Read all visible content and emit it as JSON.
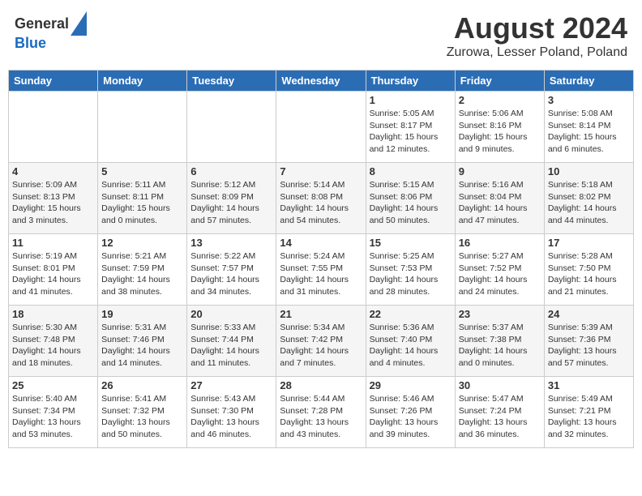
{
  "header": {
    "logo_general": "General",
    "logo_blue": "Blue",
    "month_title": "August 2024",
    "location": "Zurowa, Lesser Poland, Poland"
  },
  "days_of_week": [
    "Sunday",
    "Monday",
    "Tuesday",
    "Wednesday",
    "Thursday",
    "Friday",
    "Saturday"
  ],
  "weeks": [
    [
      {
        "day": "",
        "info": ""
      },
      {
        "day": "",
        "info": ""
      },
      {
        "day": "",
        "info": ""
      },
      {
        "day": "",
        "info": ""
      },
      {
        "day": "1",
        "info": "Sunrise: 5:05 AM\nSunset: 8:17 PM\nDaylight: 15 hours\nand 12 minutes."
      },
      {
        "day": "2",
        "info": "Sunrise: 5:06 AM\nSunset: 8:16 PM\nDaylight: 15 hours\nand 9 minutes."
      },
      {
        "day": "3",
        "info": "Sunrise: 5:08 AM\nSunset: 8:14 PM\nDaylight: 15 hours\nand 6 minutes."
      }
    ],
    [
      {
        "day": "4",
        "info": "Sunrise: 5:09 AM\nSunset: 8:13 PM\nDaylight: 15 hours\nand 3 minutes."
      },
      {
        "day": "5",
        "info": "Sunrise: 5:11 AM\nSunset: 8:11 PM\nDaylight: 15 hours\nand 0 minutes."
      },
      {
        "day": "6",
        "info": "Sunrise: 5:12 AM\nSunset: 8:09 PM\nDaylight: 14 hours\nand 57 minutes."
      },
      {
        "day": "7",
        "info": "Sunrise: 5:14 AM\nSunset: 8:08 PM\nDaylight: 14 hours\nand 54 minutes."
      },
      {
        "day": "8",
        "info": "Sunrise: 5:15 AM\nSunset: 8:06 PM\nDaylight: 14 hours\nand 50 minutes."
      },
      {
        "day": "9",
        "info": "Sunrise: 5:16 AM\nSunset: 8:04 PM\nDaylight: 14 hours\nand 47 minutes."
      },
      {
        "day": "10",
        "info": "Sunrise: 5:18 AM\nSunset: 8:02 PM\nDaylight: 14 hours\nand 44 minutes."
      }
    ],
    [
      {
        "day": "11",
        "info": "Sunrise: 5:19 AM\nSunset: 8:01 PM\nDaylight: 14 hours\nand 41 minutes."
      },
      {
        "day": "12",
        "info": "Sunrise: 5:21 AM\nSunset: 7:59 PM\nDaylight: 14 hours\nand 38 minutes."
      },
      {
        "day": "13",
        "info": "Sunrise: 5:22 AM\nSunset: 7:57 PM\nDaylight: 14 hours\nand 34 minutes."
      },
      {
        "day": "14",
        "info": "Sunrise: 5:24 AM\nSunset: 7:55 PM\nDaylight: 14 hours\nand 31 minutes."
      },
      {
        "day": "15",
        "info": "Sunrise: 5:25 AM\nSunset: 7:53 PM\nDaylight: 14 hours\nand 28 minutes."
      },
      {
        "day": "16",
        "info": "Sunrise: 5:27 AM\nSunset: 7:52 PM\nDaylight: 14 hours\nand 24 minutes."
      },
      {
        "day": "17",
        "info": "Sunrise: 5:28 AM\nSunset: 7:50 PM\nDaylight: 14 hours\nand 21 minutes."
      }
    ],
    [
      {
        "day": "18",
        "info": "Sunrise: 5:30 AM\nSunset: 7:48 PM\nDaylight: 14 hours\nand 18 minutes."
      },
      {
        "day": "19",
        "info": "Sunrise: 5:31 AM\nSunset: 7:46 PM\nDaylight: 14 hours\nand 14 minutes."
      },
      {
        "day": "20",
        "info": "Sunrise: 5:33 AM\nSunset: 7:44 PM\nDaylight: 14 hours\nand 11 minutes."
      },
      {
        "day": "21",
        "info": "Sunrise: 5:34 AM\nSunset: 7:42 PM\nDaylight: 14 hours\nand 7 minutes."
      },
      {
        "day": "22",
        "info": "Sunrise: 5:36 AM\nSunset: 7:40 PM\nDaylight: 14 hours\nand 4 minutes."
      },
      {
        "day": "23",
        "info": "Sunrise: 5:37 AM\nSunset: 7:38 PM\nDaylight: 14 hours\nand 0 minutes."
      },
      {
        "day": "24",
        "info": "Sunrise: 5:39 AM\nSunset: 7:36 PM\nDaylight: 13 hours\nand 57 minutes."
      }
    ],
    [
      {
        "day": "25",
        "info": "Sunrise: 5:40 AM\nSunset: 7:34 PM\nDaylight: 13 hours\nand 53 minutes."
      },
      {
        "day": "26",
        "info": "Sunrise: 5:41 AM\nSunset: 7:32 PM\nDaylight: 13 hours\nand 50 minutes."
      },
      {
        "day": "27",
        "info": "Sunrise: 5:43 AM\nSunset: 7:30 PM\nDaylight: 13 hours\nand 46 minutes."
      },
      {
        "day": "28",
        "info": "Sunrise: 5:44 AM\nSunset: 7:28 PM\nDaylight: 13 hours\nand 43 minutes."
      },
      {
        "day": "29",
        "info": "Sunrise: 5:46 AM\nSunset: 7:26 PM\nDaylight: 13 hours\nand 39 minutes."
      },
      {
        "day": "30",
        "info": "Sunrise: 5:47 AM\nSunset: 7:24 PM\nDaylight: 13 hours\nand 36 minutes."
      },
      {
        "day": "31",
        "info": "Sunrise: 5:49 AM\nSunset: 7:21 PM\nDaylight: 13 hours\nand 32 minutes."
      }
    ]
  ]
}
